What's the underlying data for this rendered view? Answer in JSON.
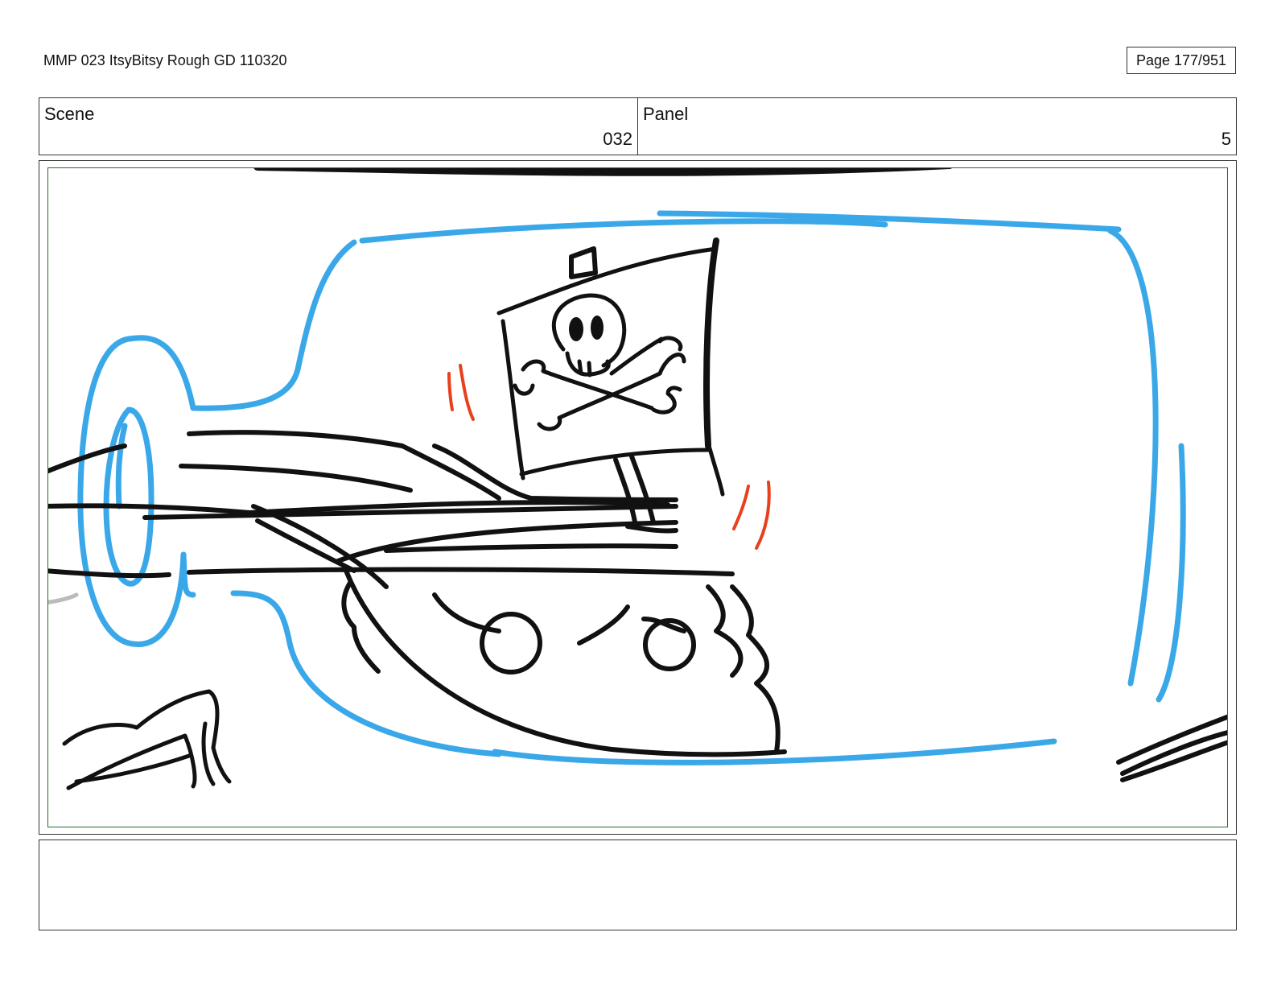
{
  "header": {
    "doc_title": "MMP 023 ItsyBitsy Rough GD 110320",
    "page_label": "Page 177/951"
  },
  "scene": {
    "label": "Scene",
    "value": "032"
  },
  "panel": {
    "label": "Panel",
    "value": "5"
  },
  "drawing": {
    "bottle_color": "#3aa8e8",
    "ink_color": "#111111",
    "motion_color": "#e8401c",
    "safe_frame_color": "#2e6b2a"
  },
  "notes": {
    "text": ""
  }
}
